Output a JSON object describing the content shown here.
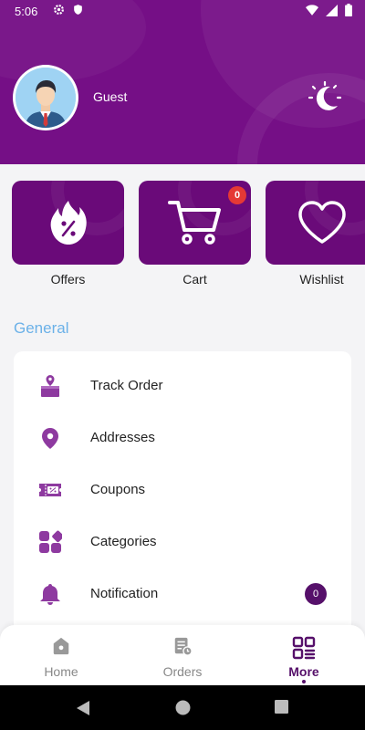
{
  "status_bar": {
    "time": "5:06"
  },
  "header": {
    "username": "Guest",
    "bg_color": "#750f86"
  },
  "quick_actions": [
    {
      "label": "Offers",
      "icon": "fire-percent-icon"
    },
    {
      "label": "Cart",
      "icon": "cart-icon",
      "badge": "0"
    },
    {
      "label": "Wishlist",
      "icon": "heart-icon"
    }
  ],
  "general": {
    "title": "General",
    "items": [
      {
        "label": "Track Order",
        "icon": "track-order-icon"
      },
      {
        "label": "Addresses",
        "icon": "location-pin-icon"
      },
      {
        "label": "Coupons",
        "icon": "coupon-icon"
      },
      {
        "label": "Categories",
        "icon": "categories-icon"
      },
      {
        "label": "Notification",
        "icon": "bell-icon",
        "badge": "0"
      }
    ]
  },
  "bottom_nav": {
    "items": [
      {
        "label": "Home",
        "icon": "home-icon"
      },
      {
        "label": "Orders",
        "icon": "orders-icon"
      },
      {
        "label": "More",
        "icon": "grid-icon",
        "active": true
      }
    ]
  },
  "colors": {
    "accent": "#750f86",
    "section_title": "#6bb1e8",
    "badge_red": "#e53935"
  }
}
